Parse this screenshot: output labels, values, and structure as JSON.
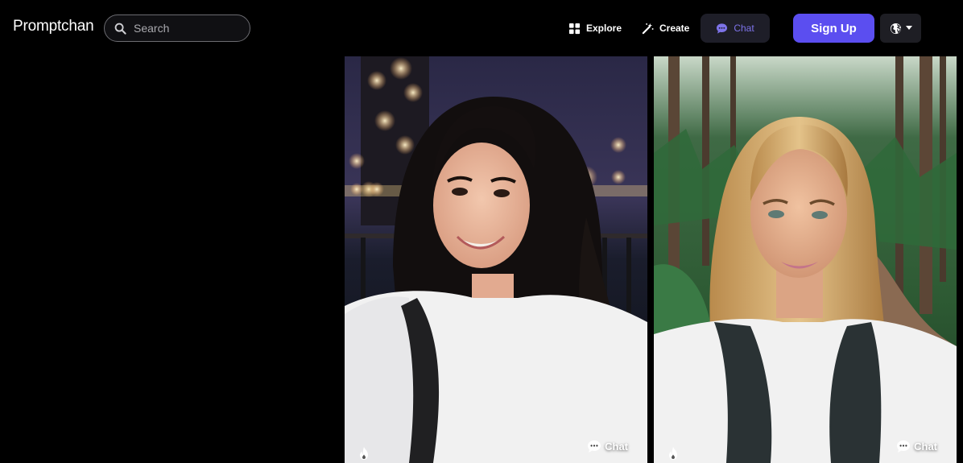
{
  "header": {
    "logo": "Promptchan",
    "search": {
      "placeholder": "Search",
      "value": ""
    },
    "nav": {
      "explore": "Explore",
      "create": "Create",
      "chat": "Chat"
    },
    "signup_label": "Sign Up",
    "language_icon": "globe-icon"
  },
  "cards": [
    {
      "chat_label": "Chat",
      "icon_left": "fire-icon",
      "icon_right": "chat-bubble-icon"
    },
    {
      "chat_label": "Chat",
      "icon_left": "fire-icon",
      "icon_right": "chat-bubble-icon"
    }
  ],
  "colors": {
    "background": "#000000",
    "accent": "#5b4ef0",
    "chat_active_bg": "#1e1e28",
    "chat_active_text": "#7d73e8"
  }
}
